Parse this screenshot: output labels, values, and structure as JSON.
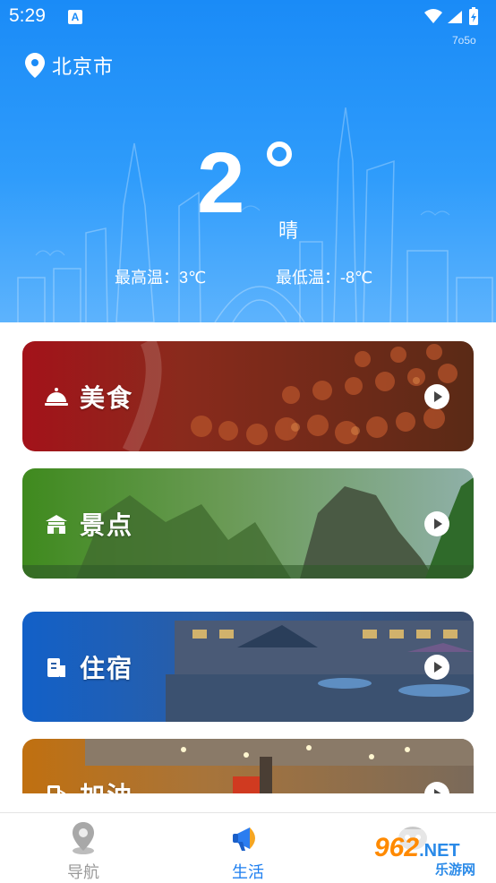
{
  "status_bar": {
    "time": "5:29",
    "notification_icon": "A"
  },
  "brand_mark": "7o5o",
  "location": {
    "city": "北京市"
  },
  "weather": {
    "temperature": "2",
    "condition": "晴",
    "high": "最高温：3℃",
    "low": "最低温：-8℃"
  },
  "cards": [
    {
      "label": "美食",
      "icon": "food-cloche-icon"
    },
    {
      "label": "景点",
      "icon": "scenic-building-icon"
    },
    {
      "label": "住宿",
      "icon": "hotel-icon"
    },
    {
      "label": "加油",
      "icon": "gas-station-icon"
    }
  ],
  "tabs": [
    {
      "label": "导航",
      "icon": "map-pin-icon",
      "active": false
    },
    {
      "label": "生活",
      "icon": "megaphone-icon",
      "active": true
    },
    {
      "label": "",
      "icon": "robot-face-icon",
      "active": false
    }
  ],
  "watermark": {
    "text": "962",
    "suffix": ".NET",
    "subtext": "乐游网"
  },
  "colors": {
    "accent": "#1e7ff0",
    "header": "#1a8bf7",
    "inactive": "#9a9a9a"
  }
}
